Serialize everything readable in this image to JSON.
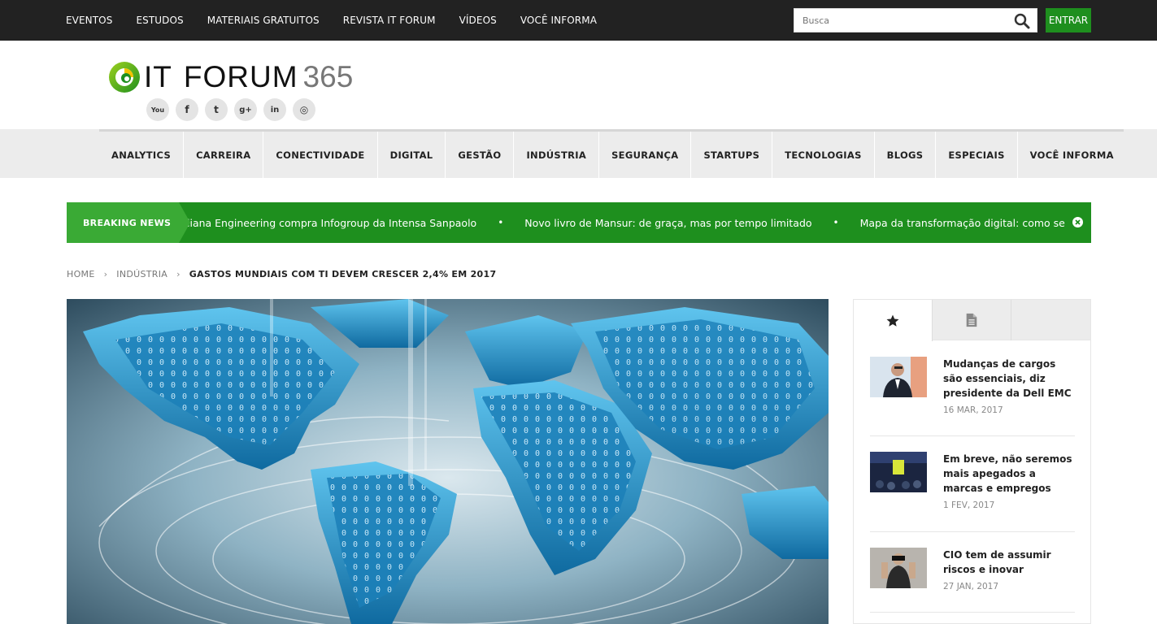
{
  "topnav": {
    "items": [
      "EVENTOS",
      "ESTUDOS",
      "MATERIAIS GRATUITOS",
      "REVISTA IT FORUM",
      "VÍDEOS",
      "VOCÊ INFORMA"
    ]
  },
  "search": {
    "placeholder": "Busca"
  },
  "login": {
    "label": "ENTRAR"
  },
  "logo": {
    "it": "IT",
    "forum": "FORUM",
    "num": "365"
  },
  "social": {
    "icons": [
      "youtube-icon",
      "facebook-icon",
      "twitter-icon",
      "google-plus-icon",
      "linkedin-icon",
      "instagram-icon"
    ],
    "glyphs": [
      "You",
      "f",
      "t",
      "g+",
      "in",
      "◎"
    ]
  },
  "mainnav": {
    "items": [
      "ANALYTICS",
      "CARREIRA",
      "CONECTIVIDADE",
      "DIGITAL",
      "GESTÃO",
      "INDÚSTRIA",
      "SEGURANÇA",
      "STARTUPS",
      "TECNOLOGIAS",
      "BLOGS",
      "ESPECIAIS",
      "VOCÊ INFORMA"
    ]
  },
  "breaking": {
    "label": "BREAKING NEWS",
    "items": [
      "liana Engineering compra Infogroup da Intensa Sanpaolo",
      "Novo livro de Mansur: de graça, mas por tempo limitado",
      "Mapa da transformação digital: como se adaptar à nova er"
    ],
    "separator": "•"
  },
  "breadcrumb": {
    "home": "HOME",
    "section": "INDÚSTRIA",
    "current": "GASTOS MUNDIAIS COM TI DEVEM CRESCER 2,4% EM 2017"
  },
  "colors": {
    "topbar": "#222222",
    "green": "#1e8f1e",
    "green_light": "#3aaa35"
  },
  "sidebar": {
    "tabs": [
      "star-icon",
      "document-icon"
    ],
    "news": [
      {
        "title": "Mudanças de cargos são essenciais, diz presidente da Dell EMC",
        "date": "16 MAR, 2017"
      },
      {
        "title": "Em breve, não seremos mais apegados a marcas e empregos",
        "date": "1 FEV, 2017"
      },
      {
        "title": "CIO tem de assumir riscos e inovar",
        "date": "27 JAN, 2017"
      }
    ]
  }
}
